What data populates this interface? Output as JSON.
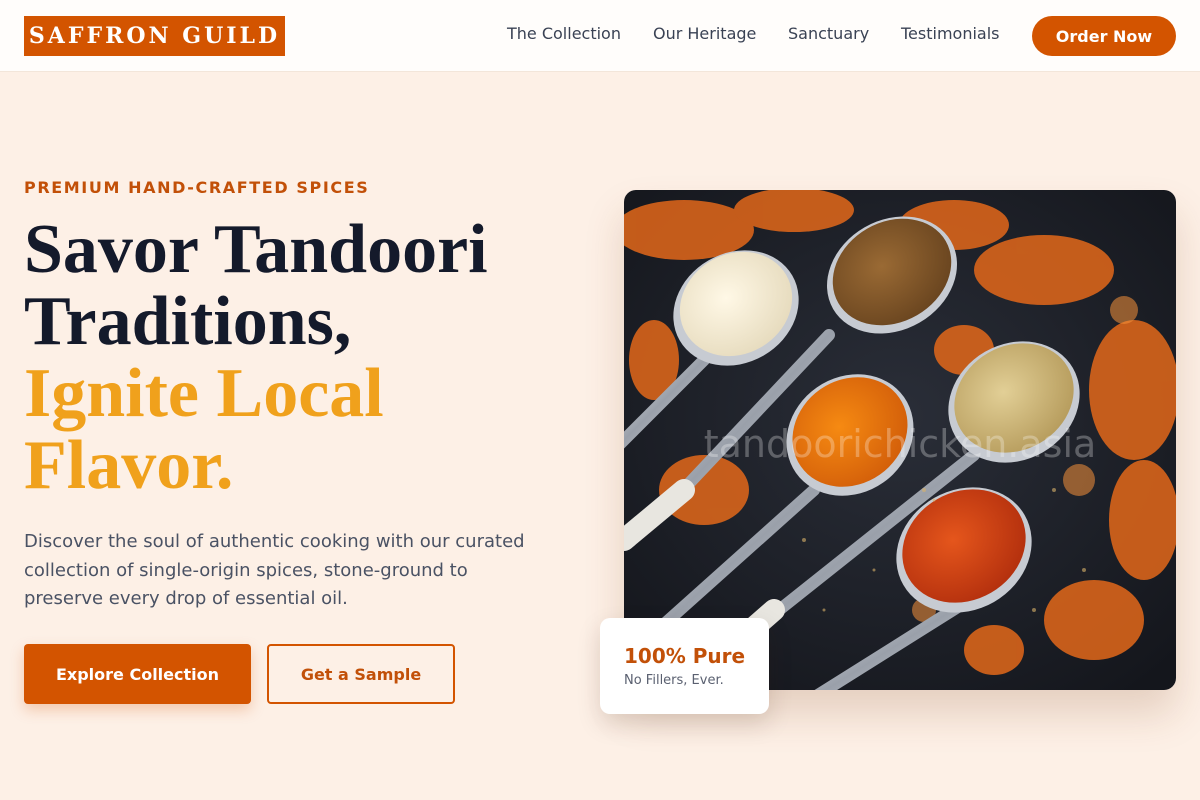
{
  "header": {
    "logo": "SAFFRON GUILD",
    "nav": [
      "The Collection",
      "Our Heritage",
      "Sanctuary",
      "Testimonials"
    ],
    "cta": "Order Now"
  },
  "hero": {
    "eyebrow": "PREMIUM HAND-CRAFTED SPICES",
    "headline_line1": "Savor Tandoori",
    "headline_line2": "Traditions,",
    "headline_accent1": "Ignite Local",
    "headline_accent2": "Flavor.",
    "description": "Discover the soul of authentic cooking with our curated collection of single-origin spices, stone-ground to preserve every drop of essential oil.",
    "primary_button": "Explore Collection",
    "secondary_button": "Get a Sample",
    "image_watermark": "tandoorichicken.asia",
    "badge_title": "100% Pure",
    "badge_subtitle": "No Fillers, Ever."
  },
  "colors": {
    "brand": "#d35400",
    "accent": "#f0a11c",
    "background": "#fdf0e6",
    "headline": "#141a2b"
  }
}
